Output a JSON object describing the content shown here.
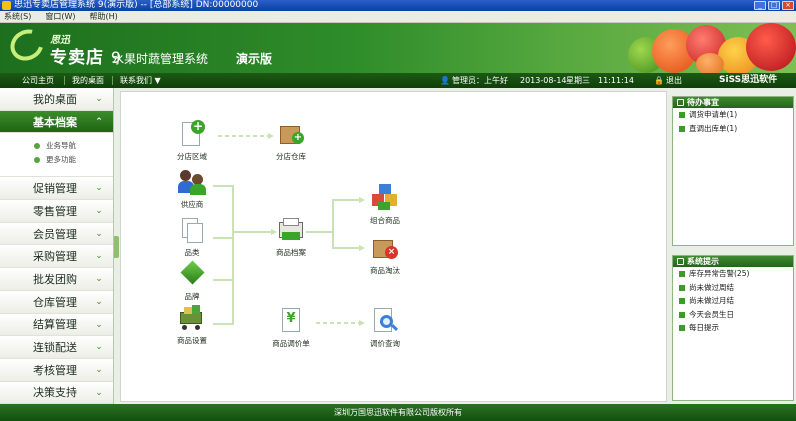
{
  "window": {
    "title": "思迅专卖店管理系统 9(演示版) -- [总部系统] DN:00000000",
    "minimize": "_",
    "maximize": "□",
    "close": "×"
  },
  "menu": [
    "系统(S)",
    "窗口(W)",
    "帮助(H)"
  ],
  "banner": {
    "brand_small": "思迅",
    "brand_big": "专卖店",
    "version_digit": "9",
    "subtitle": "水果时蔬管理系统",
    "edition": "演示版"
  },
  "nav": {
    "links": [
      "公司主页",
      "我的桌面",
      "联系我们 ▼"
    ],
    "operator": "管理员：上午好",
    "date": "2013-08-14",
    "weekday": "星期三",
    "time": "11:11:14",
    "exit": "退出",
    "logo": "SiSS思迅软件"
  },
  "sidebar": {
    "items": [
      {
        "label": "我的桌面",
        "active": false
      },
      {
        "label": "基本档案",
        "active": true
      },
      {
        "label": "促销管理",
        "active": false
      },
      {
        "label": "零售管理",
        "active": false
      },
      {
        "label": "会员管理",
        "active": false
      },
      {
        "label": "采购管理",
        "active": false
      },
      {
        "label": "批发团购",
        "active": false
      },
      {
        "label": "仓库管理",
        "active": false
      },
      {
        "label": "结算管理",
        "active": false
      },
      {
        "label": "连锁配送",
        "active": false
      },
      {
        "label": "考核管理",
        "active": false
      },
      {
        "label": "决策支持",
        "active": false
      }
    ],
    "sub_items": [
      "业务导航",
      "更多功能"
    ]
  },
  "flow": {
    "nodes": [
      {
        "id": "branch-area",
        "label": "分店区域",
        "icon": "document-plus-icon"
      },
      {
        "id": "branch-warehouse",
        "label": "分店仓库",
        "icon": "box-plus-icon"
      },
      {
        "id": "supplier",
        "label": "供应商",
        "icon": "people-icon"
      },
      {
        "id": "category",
        "label": "品类",
        "icon": "documents-icon"
      },
      {
        "id": "brand",
        "label": "品牌",
        "icon": "diamond-icon"
      },
      {
        "id": "product-settings",
        "label": "商品设置",
        "icon": "cart-icon"
      },
      {
        "id": "product-archive",
        "label": "商品档案",
        "icon": "printer-icon"
      },
      {
        "id": "combo-product",
        "label": "组合商品",
        "icon": "cubes-icon"
      },
      {
        "id": "product-retire",
        "label": "商品淘汰",
        "icon": "box-x-icon"
      },
      {
        "id": "price-adjust",
        "label": "商品调价单",
        "icon": "yen-document-icon"
      },
      {
        "id": "price-query",
        "label": "调价查询",
        "icon": "magnifier-document-icon"
      }
    ]
  },
  "panels": {
    "todo": {
      "title": "待办事宜",
      "items": [
        "调货申请单(1)",
        "直调出库单(1)"
      ]
    },
    "system": {
      "title": "系统提示",
      "items": [
        "库存异常告警(25)",
        "尚未做过周结",
        "尚未做过月结",
        "今天会员生日",
        "每日提示"
      ]
    }
  },
  "footer": "深圳万国思迅软件有限公司版权所有",
  "colors": {
    "brand_green": "#2f8d2a",
    "nav_dark": "#0f3f09",
    "accent_light": "#c7ee7a"
  }
}
